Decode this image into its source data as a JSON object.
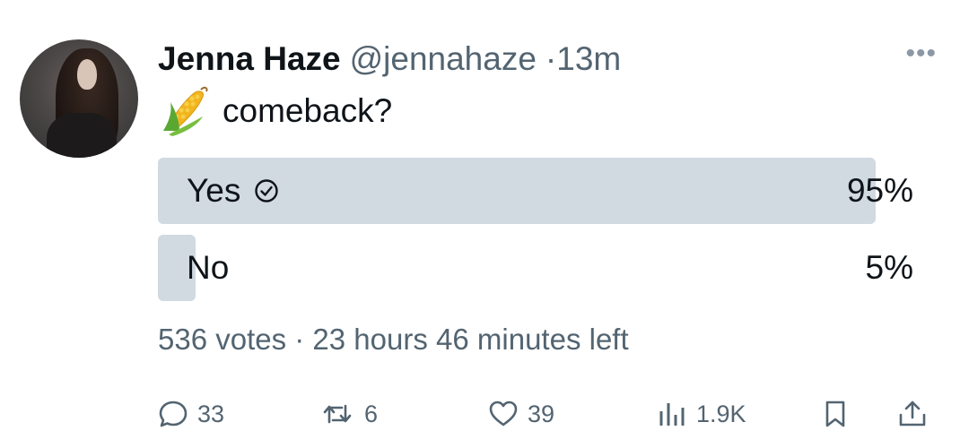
{
  "tweet": {
    "author_name": "Jenna Haze",
    "handle": "@jennahaze",
    "separator": "·",
    "time_ago": "13m",
    "text": "comeback?",
    "emoji": "corn-emoji"
  },
  "poll": {
    "options": [
      {
        "label": "Yes",
        "percent_label": "95%",
        "percent": 95,
        "selected": true
      },
      {
        "label": "No",
        "percent_label": "5%",
        "percent": 5,
        "selected": false
      }
    ],
    "meta": "536 votes · 23 hours 46 minutes left"
  },
  "actions": {
    "replies": "33",
    "reposts": "6",
    "likes": "39",
    "views": "1.9K"
  },
  "colors": {
    "bar": "#d1d9e1",
    "secondary_text": "#536471",
    "primary_text": "#0f1419"
  },
  "icons": [
    "more-icon",
    "check-circle-icon",
    "reply-icon",
    "repost-icon",
    "like-icon",
    "views-icon",
    "bookmark-icon",
    "share-icon"
  ]
}
